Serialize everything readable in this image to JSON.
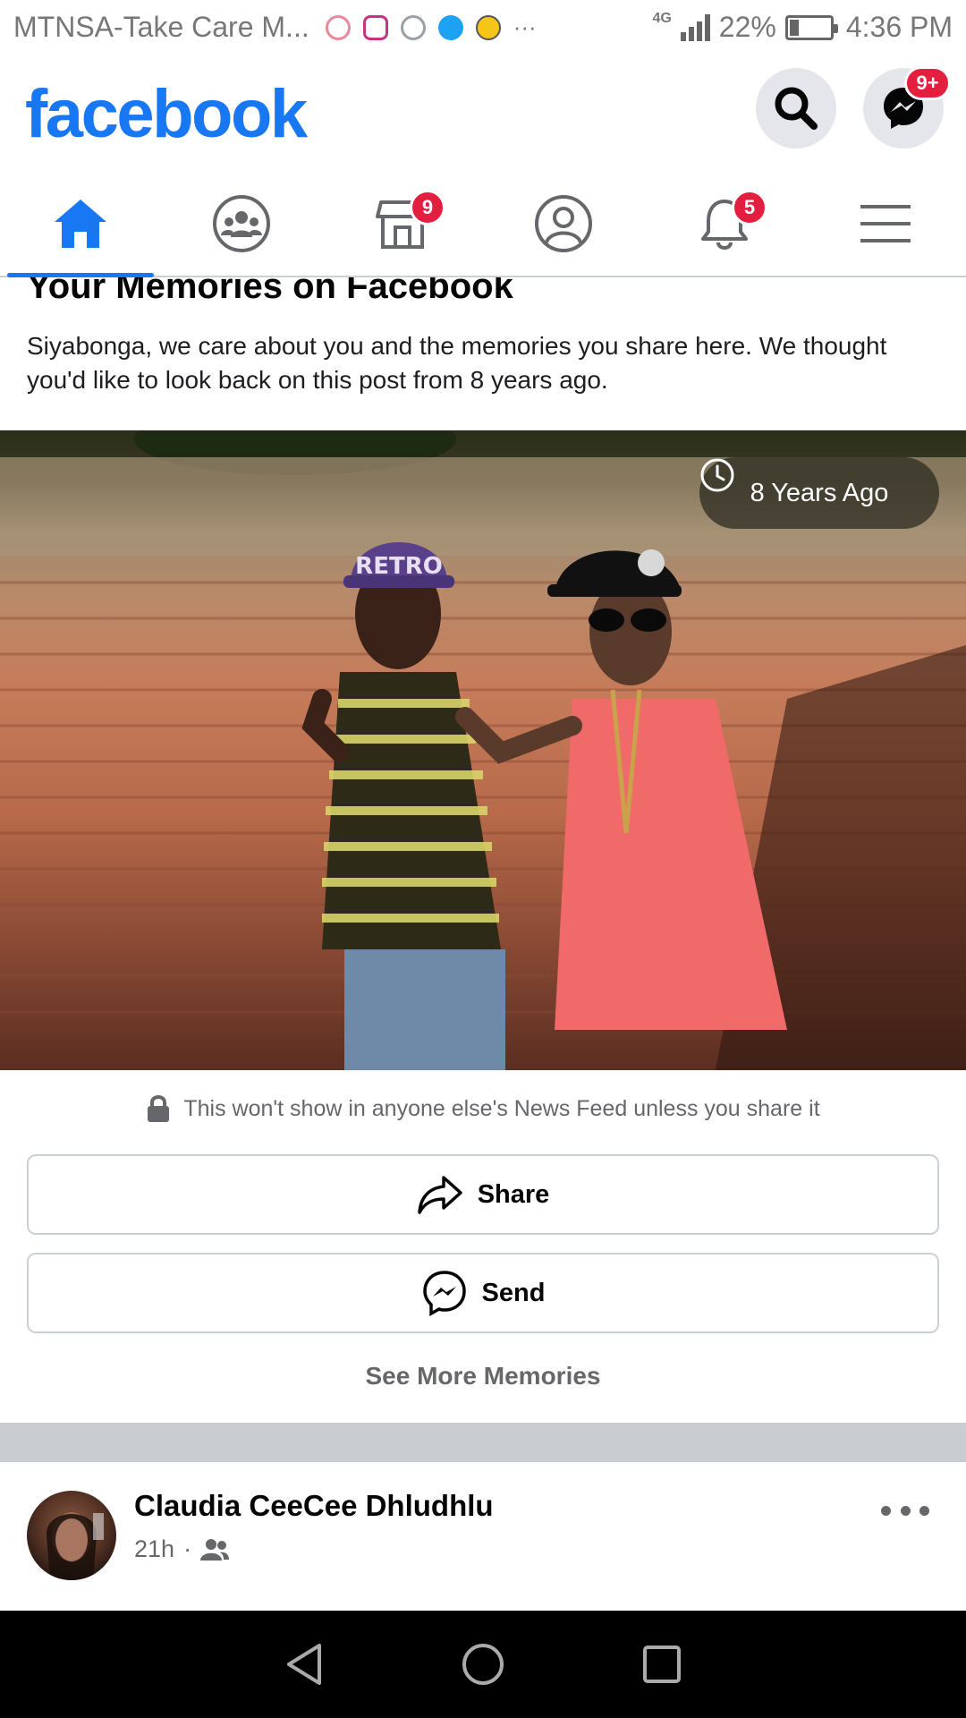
{
  "status_bar": {
    "carrier": "MTNSA-Take Care M...",
    "overflow": "···",
    "network": "4G",
    "battery_percent": "22%",
    "battery_level": 0.22,
    "time": "4:36 PM",
    "notification_icons": [
      "alarm-icon",
      "instagram-icon",
      "google-icon",
      "twitter-icon",
      "emoji-icon"
    ]
  },
  "header": {
    "logo": "facebook",
    "messenger_badge": "9+",
    "brand_color": "#1877f2",
    "badge_color": "#e41e3f"
  },
  "nav_tabs": [
    {
      "name": "home",
      "icon": "home-icon",
      "active": true
    },
    {
      "name": "groups",
      "icon": "groups-icon"
    },
    {
      "name": "marketplace",
      "icon": "marketplace-icon",
      "badge": "9"
    },
    {
      "name": "profile",
      "icon": "profile-icon"
    },
    {
      "name": "notifications",
      "icon": "bell-icon",
      "badge": "5"
    },
    {
      "name": "menu",
      "icon": "hamburger-menu-icon"
    }
  ],
  "memories": {
    "title": "Your Memories on Facebook",
    "description": "Siyabonga, we care about you and the memories you share here. We thought you'd like to look back on this post from 8 years ago.",
    "time_ago": "8 Years Ago",
    "photo_cap_text": "RETRO",
    "privacy_note": "This won't show in anyone else's News Feed unless you share it",
    "share_label": "Share",
    "send_label": "Send",
    "see_more_label": "See More Memories"
  },
  "next_post": {
    "author": "Claudia CeeCee Dhludhlu",
    "time": "21h",
    "separator": "·",
    "audience_icon": "friends-icon"
  }
}
